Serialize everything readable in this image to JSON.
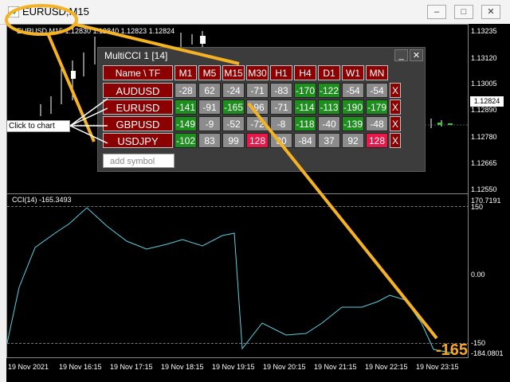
{
  "window": {
    "title": "EURUSD,M15"
  },
  "chart": {
    "symbol_info": "EURUSD,M15  1.12830 1.12840 1.12823 1.12824",
    "price_current": "1.12824",
    "price_labels": [
      "1.13235",
      "1.13120",
      "1.13005",
      "1.12890",
      "1.12780",
      "1.12665",
      "1.12550"
    ],
    "indicator_label": "CCI(14) -165.3493",
    "indicator_labels": [
      "170.7191",
      "150",
      "0.00",
      "-150",
      "-184.0801"
    ],
    "cci_value": "-165",
    "time_labels": [
      "19 Nov 2021",
      "19 Nov 16:15",
      "19 Nov 17:15",
      "19 Nov 18:15",
      "19 Nov 19:15",
      "19 Nov 20:15",
      "19 Nov 21:15",
      "19 Nov 22:15",
      "19 Nov 23:15"
    ]
  },
  "panel": {
    "title": "MultiCCI 1 [14]",
    "header_first": "Name \\ TF",
    "timeframes": [
      "M1",
      "M5",
      "M15",
      "M30",
      "H1",
      "H4",
      "D1",
      "W1",
      "MN"
    ],
    "rows": [
      {
        "symbol": "AUDUSD",
        "values": [
          "-28",
          "62",
          "-24",
          "-71",
          "-83",
          "-170",
          "-122",
          "-54",
          "-54"
        ]
      },
      {
        "symbol": "EURUSD",
        "values": [
          "-141",
          "-91",
          "-165",
          "-96",
          "-71",
          "-114",
          "-113",
          "-190",
          "-179"
        ]
      },
      {
        "symbol": "GBPUSD",
        "values": [
          "-149",
          "-9",
          "-52",
          "-72",
          "-8",
          "-118",
          "-40",
          "-139",
          "-48"
        ]
      },
      {
        "symbol": "USDJPY",
        "values": [
          "-102",
          "83",
          "99",
          "128",
          "30",
          "-84",
          "37",
          "92",
          "128"
        ]
      }
    ],
    "close_label": "X",
    "add_placeholder": "add symbol",
    "minimize_label": "_",
    "close_panel_label": "✕"
  },
  "callout": {
    "text": "Click to chart"
  },
  "colors": {
    "green": "#1e8f1e",
    "grey": "#8c8c8c",
    "red": "#e8194a",
    "darkred": "#8b0000",
    "highlight": "#f5b323"
  }
}
